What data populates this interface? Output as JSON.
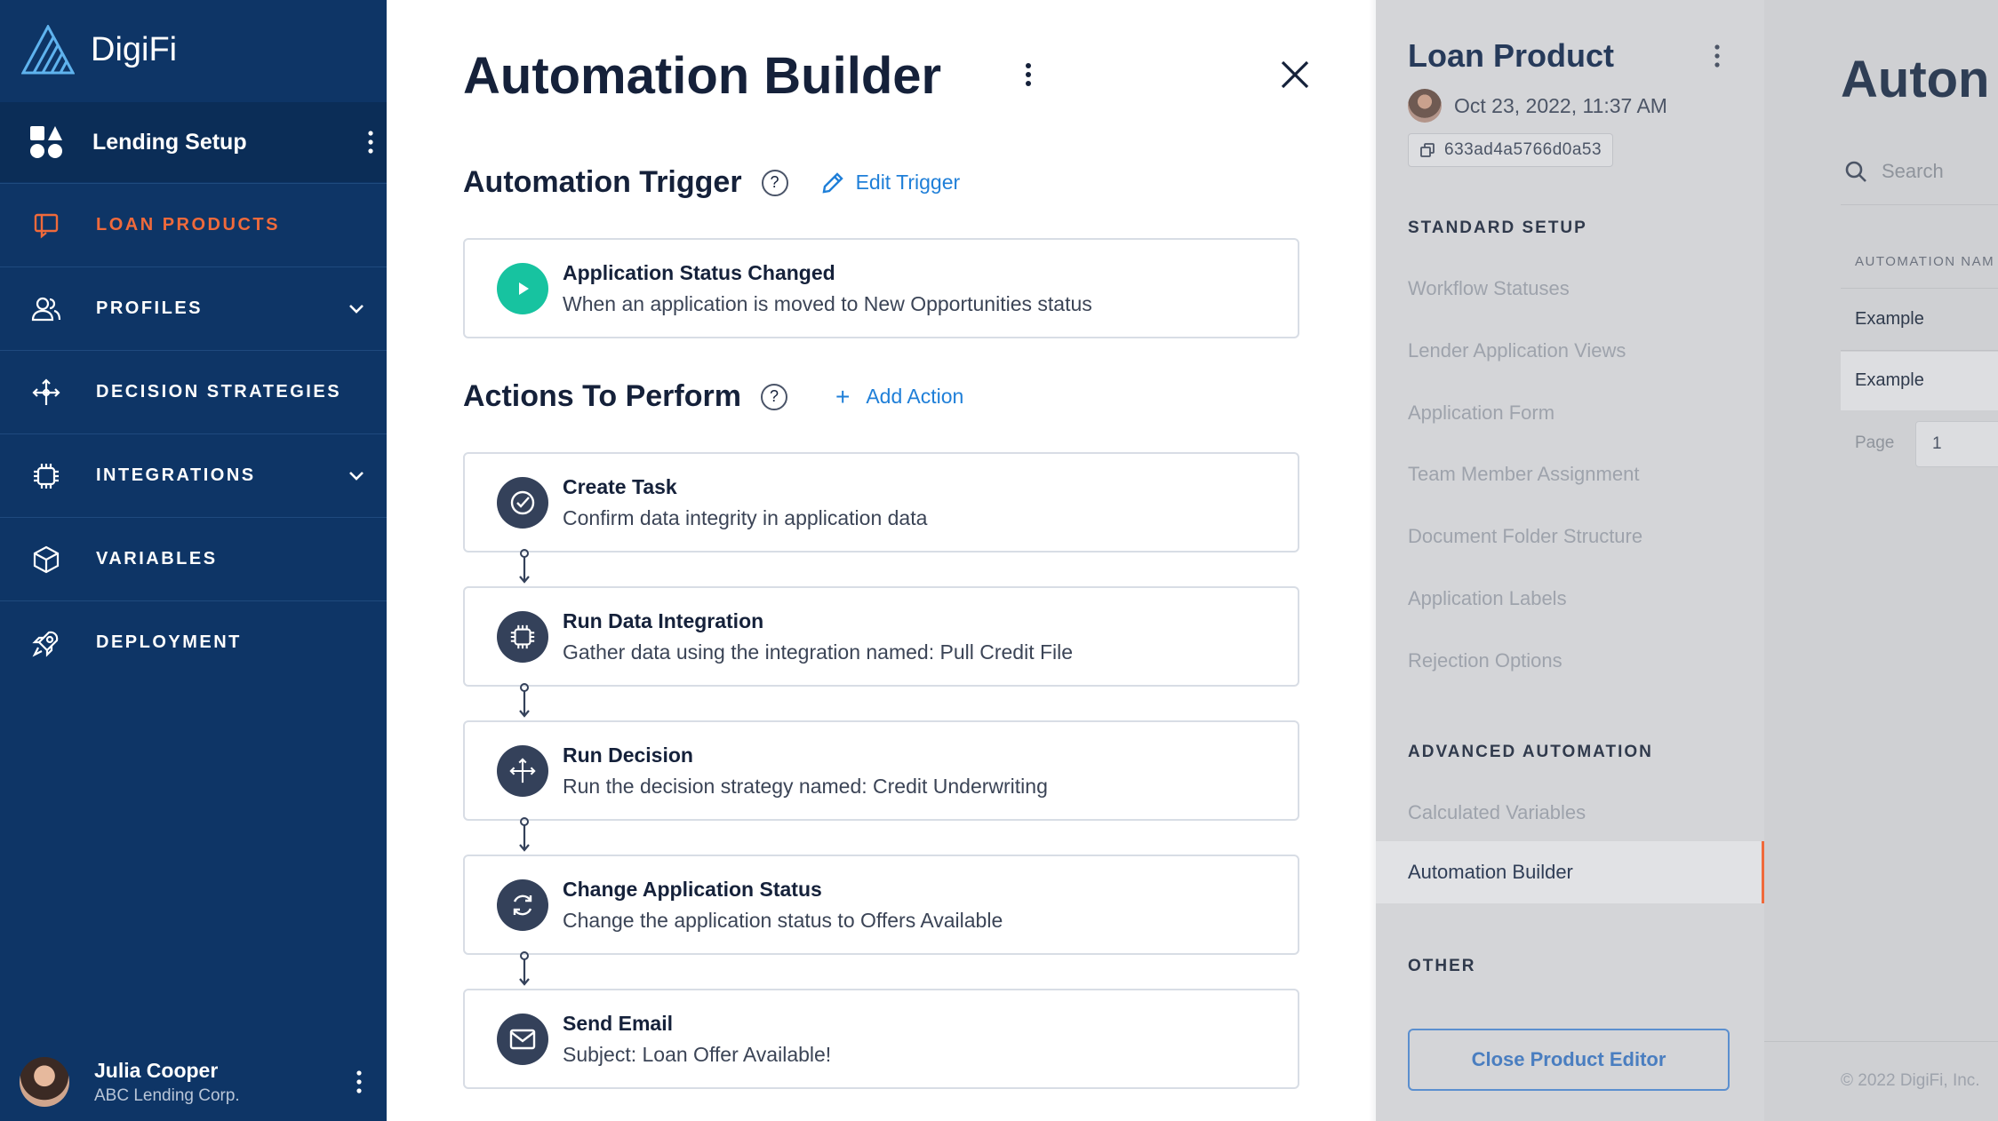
{
  "brand": {
    "name": "DigiFi"
  },
  "workspace": {
    "label": "Lending Setup"
  },
  "nav": {
    "items": [
      {
        "label": "LOAN PRODUCTS",
        "icon": "loan-products-icon",
        "active": true
      },
      {
        "label": "PROFILES",
        "icon": "profiles-icon",
        "expandable": true
      },
      {
        "label": "DECISION STRATEGIES",
        "icon": "decision-strategies-icon"
      },
      {
        "label": "INTEGRATIONS",
        "icon": "integrations-icon",
        "expandable": true
      },
      {
        "label": "VARIABLES",
        "icon": "variables-icon"
      },
      {
        "label": "DEPLOYMENT",
        "icon": "deployment-icon"
      }
    ]
  },
  "user": {
    "name": "Julia Cooper",
    "org": "ABC Lending Corp."
  },
  "builder": {
    "title": "Automation Builder",
    "trigger_section": {
      "title": "Automation Trigger",
      "help": "?",
      "edit_label": "Edit Trigger"
    },
    "trigger": {
      "title": "Application Status Changed",
      "description": "When an application is moved to New Opportunities status"
    },
    "actions_section": {
      "title": "Actions To Perform",
      "help": "?",
      "add_label": "Add Action",
      "add_symbol": "+"
    },
    "actions": [
      {
        "title": "Create Task",
        "description": "Confirm data integrity in application data",
        "icon": "check-circle-icon"
      },
      {
        "title": "Run Data Integration",
        "description": "Gather data using the integration named: Pull Credit File",
        "icon": "chip-icon"
      },
      {
        "title": "Run Decision",
        "description": "Run the decision strategy named: Credit Underwriting",
        "icon": "decision-arrows-icon"
      },
      {
        "title": "Change Application Status",
        "description": "Change the application status to Offers Available",
        "icon": "refresh-icon"
      },
      {
        "title": "Send Email",
        "description": "Subject: Loan Offer Available!",
        "icon": "envelope-icon"
      }
    ]
  },
  "product_panel": {
    "title": "Loan Product",
    "date": "Oct 23, 2022, 11:37 AM",
    "id": "633ad4a5766d0a53",
    "standard_setup": {
      "heading": "STANDARD SETUP",
      "items": [
        "Workflow Statuses",
        "Lender Application Views",
        "Application Form",
        "Team Member Assignment",
        "Document Folder Structure",
        "Application Labels",
        "Rejection Options"
      ]
    },
    "advanced_automation": {
      "heading": "ADVANCED AUTOMATION",
      "items": [
        "Calculated Variables",
        "Automation Builder"
      ]
    },
    "other": {
      "heading": "OTHER"
    },
    "close_label": "Close Product Editor"
  },
  "background_page": {
    "title": "Auton",
    "search_placeholder": "Search",
    "column_header": "AUTOMATION NAM",
    "rows": [
      "Example",
      "Example"
    ],
    "page_label": "Page",
    "page_value": "1",
    "footer": "© 2022 DigiFi, Inc."
  },
  "colors": {
    "sidebar": "#0e3566",
    "accent_orange": "#f06a3b",
    "link_blue": "#1f7fd8",
    "trigger_green": "#17c3a0",
    "icon_dark": "#34415a"
  }
}
